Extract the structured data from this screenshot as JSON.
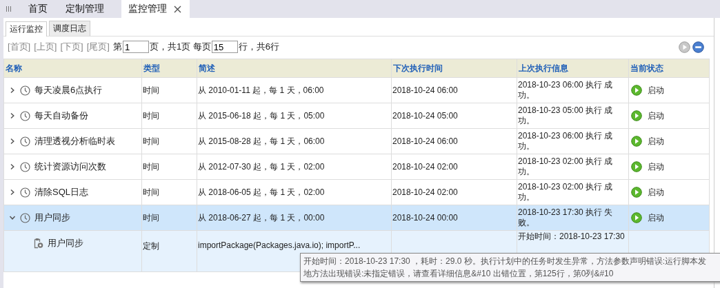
{
  "main_tabs": [
    {
      "label": "首页",
      "selected": false,
      "closable": false
    },
    {
      "label": "定制管理",
      "selected": false,
      "closable": false
    },
    {
      "label": "监控管理",
      "selected": true,
      "closable": true
    }
  ],
  "sub_tabs": [
    {
      "label": "运行监控",
      "selected": true
    },
    {
      "label": "调度日志",
      "selected": false
    }
  ],
  "pager": {
    "links": [
      "[首页]",
      "[上页]",
      "[下页]",
      "[尾页]"
    ],
    "page_prefix": "第",
    "page": "1",
    "page_suffix": "页，共1页 每页",
    "per_page": "15",
    "summary": "行，共6行"
  },
  "table": {
    "columns": [
      "名称",
      "类型",
      "简述",
      "下次执行时间",
      "上次执行信息",
      "当前状态"
    ],
    "rows": [
      {
        "name": "每天凌晨6点执行",
        "type": "时间",
        "desc": "从 2010-01-11 起，每 1 天，06:00",
        "next": "2018-10-24 06:00",
        "last": [
          "2018-10-23 06:00 执行 成功。"
        ],
        "status": "启动",
        "expanded": false,
        "selected": false,
        "children": []
      },
      {
        "name": "每天自动备份",
        "type": "时间",
        "desc": "从 2015-06-18 起，每 1 天，05:00",
        "next": "2018-10-24 05:00",
        "last": [
          "2018-10-23 05:00 执行 成功。"
        ],
        "status": "启动",
        "expanded": false,
        "selected": false,
        "children": []
      },
      {
        "name": "清理透视分析临时表",
        "type": "时间",
        "desc": "从 2015-08-28 起，每 1 天，06:00",
        "next": "2018-10-24 06:00",
        "last": [
          "2018-10-23 06:00 执行 成功。"
        ],
        "status": "启动",
        "expanded": false,
        "selected": false,
        "children": []
      },
      {
        "name": "统计资源访问次数",
        "type": "时间",
        "desc": "从 2012-07-30 起，每 1 天，02:00",
        "next": "2018-10-24 02:00",
        "last": [
          "2018-10-23 02:00 执行 成功。"
        ],
        "status": "启动",
        "expanded": false,
        "selected": false,
        "children": []
      },
      {
        "name": "清除SQL日志",
        "type": "时间",
        "desc": "从 2018-06-05 起，每 1 天，02:00",
        "next": "2018-10-24 02:00",
        "last": [
          "2018-10-23 02:00 执行 成功。"
        ],
        "status": "启动",
        "expanded": false,
        "selected": false,
        "children": []
      },
      {
        "name": "用户同步",
        "type": "时间",
        "desc": "从 2018-06-27 起，每 1 天，00:00",
        "next": "2018-10-24 00:00",
        "last": [
          "2018-10-23 17:30 执行 失败。"
        ],
        "status": "启动",
        "expanded": true,
        "selected": true,
        "children": [
          {
            "name": "用户同步",
            "type": "定制",
            "desc": "importPackage(Packages.java.io); importP...",
            "last": [
              "开始时间：2018-10-23 17:30"
            ]
          }
        ]
      }
    ]
  },
  "tooltip": [
    "开始时间：2018-10-23 17:30 ，耗时：29.0 秒。执行计划中的任务时发生异常，方法参数声明错误:运行脚本发",
    "地方法出现错误:未指定错误，请查看详细信息&#10 出错位置，第125行，第0列&#10"
  ]
}
